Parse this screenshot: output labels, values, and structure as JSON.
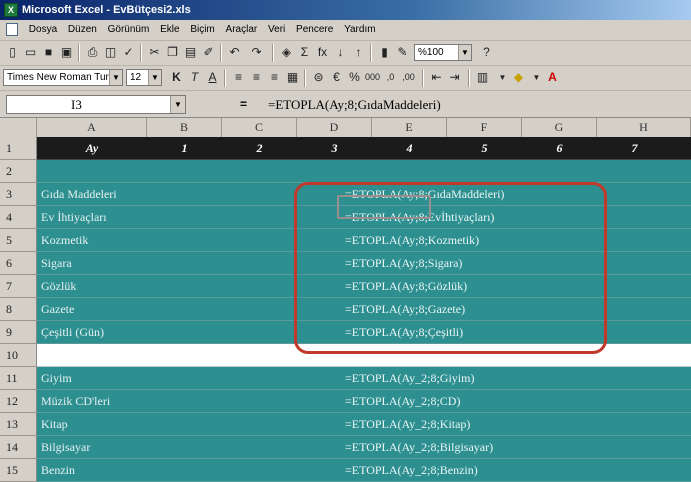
{
  "window": {
    "title": "Microsoft Excel - EvBütçesi2.xls",
    "app_icon": "excel-icon"
  },
  "menu": {
    "items": [
      {
        "label": "Dosya"
      },
      {
        "label": "Düzen"
      },
      {
        "label": "Görünüm"
      },
      {
        "label": "Ekle"
      },
      {
        "label": "Biçim"
      },
      {
        "label": "Araçlar"
      },
      {
        "label": "Veri"
      },
      {
        "label": "Pencere"
      },
      {
        "label": "Yardım"
      }
    ]
  },
  "toolbar": {
    "font_name": "Times New Roman Tur",
    "font_size": "12",
    "zoom": "%100",
    "bold_label": "K",
    "italic_label": "T",
    "underline_label": "A",
    "sum_label": "Σ",
    "fx_label": "fx",
    "currency_label": "€",
    "percent_label": "%",
    "thousands_label": "000",
    "inc_dec_label": ",0",
    "dec_dec_label": ",00"
  },
  "formula_bar": {
    "cell_ref": "I3",
    "equals": "=",
    "content": "=ETOPLA(Ay;8;GıdaMaddeleri)"
  },
  "columns": [
    "A",
    "B",
    "C",
    "D",
    "E",
    "F",
    "G",
    "H"
  ],
  "rows": [
    {
      "num": "1",
      "style": "dark",
      "header": [
        "Ay",
        "1",
        "2",
        "3",
        "4",
        "5",
        "6",
        "7"
      ]
    },
    {
      "num": "2",
      "style": "teal",
      "label": "",
      "formula": ""
    },
    {
      "num": "3",
      "style": "teal",
      "label": "Gıda Maddeleri",
      "formula": "=ETOPLA(Ay;8;GıdaMaddeleri)"
    },
    {
      "num": "4",
      "style": "teal",
      "label": "Ev İhtiyaçları",
      "formula": "=ETOPLA(Ay;8;Evİhtiyaçları)"
    },
    {
      "num": "5",
      "style": "teal",
      "label": "Kozmetik",
      "formula": "=ETOPLA(Ay;8;Kozmetik)"
    },
    {
      "num": "6",
      "style": "teal",
      "label": "Sigara",
      "formula": "=ETOPLA(Ay;8;Sigara)"
    },
    {
      "num": "7",
      "style": "teal",
      "label": "Gözlük",
      "formula": "=ETOPLA(Ay;8;Gözlük)"
    },
    {
      "num": "8",
      "style": "teal",
      "label": "Gazete",
      "formula": "=ETOPLA(Ay;8;Gazete)"
    },
    {
      "num": "9",
      "style": "teal",
      "label": "Çeşitli (Gün)",
      "formula": "=ETOPLA(Ay;8;Çeşitli)"
    },
    {
      "num": "10",
      "style": "white",
      "label": "",
      "formula": ""
    },
    {
      "num": "11",
      "style": "teal",
      "label": "Giyim",
      "formula": "=ETOPLA(Ay_2;8;Giyim)"
    },
    {
      "num": "12",
      "style": "teal",
      "label": "Müzik CD'leri",
      "formula": "=ETOPLA(Ay_2;8;CD)"
    },
    {
      "num": "13",
      "style": "teal",
      "label": "Kitap",
      "formula": "=ETOPLA(Ay_2;8;Kitap)"
    },
    {
      "num": "14",
      "style": "teal",
      "label": "Bilgisayar",
      "formula": "=ETOPLA(Ay_2;8;Bilgisayar)"
    },
    {
      "num": "15",
      "style": "teal",
      "label": "Benzin",
      "formula": "=ETOPLA(Ay_2;8;Benzin)"
    }
  ],
  "colors": {
    "teal": "#2e8f90",
    "dark_header": "#1b1b1b",
    "callout": "#c0392b"
  }
}
